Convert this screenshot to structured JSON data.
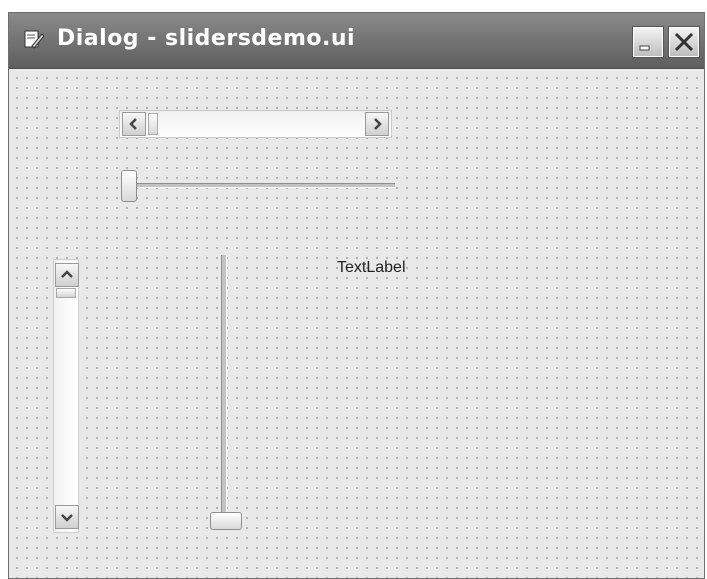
{
  "window": {
    "title": "Dialog - slidersdemo.ui",
    "controls": [
      "minimize-icon",
      "close-icon"
    ]
  },
  "widgets": {
    "horizontal_scrollbar": {
      "value_fraction": 0.0
    },
    "horizontal_slider": {
      "value_fraction": 0.0
    },
    "vertical_scrollbar": {
      "value_fraction": 0.0
    },
    "vertical_slider": {
      "value_fraction": 0.0
    },
    "label": {
      "text": "TextLabel"
    }
  },
  "icons": {
    "app": "designer-form-icon",
    "scroll_left": "chevron-left-icon",
    "scroll_right": "chevron-right-icon",
    "scroll_up": "chevron-up-icon",
    "scroll_down": "chevron-down-icon"
  },
  "colors": {
    "titlebar": "#6e6e6e",
    "client_background": "#e9e9e9",
    "grid_dots": "#a9a9a9"
  }
}
